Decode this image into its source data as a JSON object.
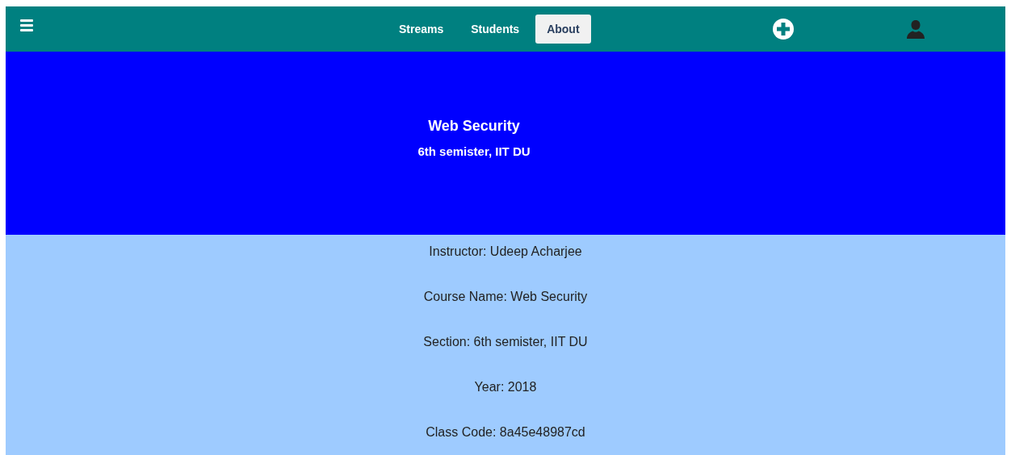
{
  "nav": {
    "tabs": [
      {
        "label": "Streams",
        "selected": false
      },
      {
        "label": "Students",
        "selected": false
      },
      {
        "label": "About",
        "selected": true
      }
    ]
  },
  "banner": {
    "title": "Web Security",
    "subtitle": "6th semister, IIT DU"
  },
  "details": [
    "Instructor: Udeep Acharjee",
    "Course Name: Web Security",
    "Section: 6th semister, IIT DU",
    "Year: 2018",
    "Class Code: 8a45e48987cd"
  ]
}
